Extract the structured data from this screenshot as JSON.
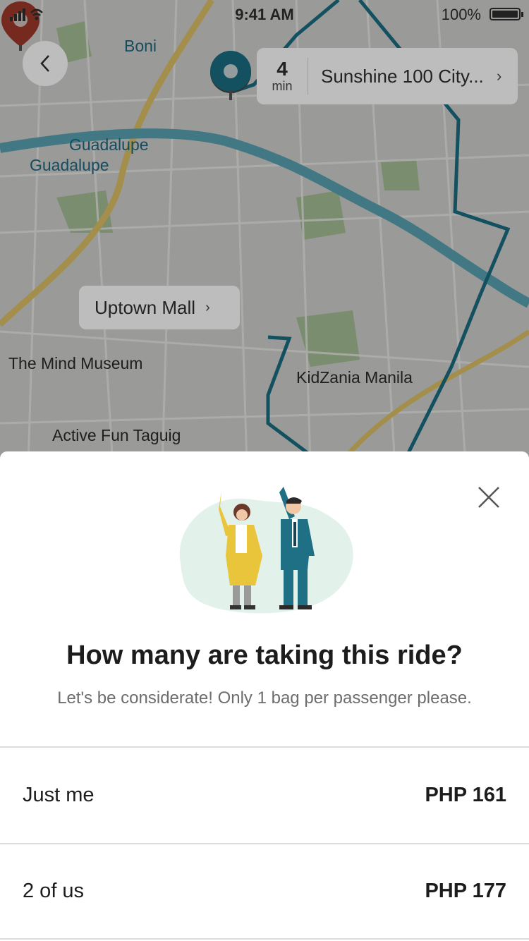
{
  "status_bar": {
    "time": "9:41 AM",
    "battery": "100%"
  },
  "map": {
    "eta": {
      "value": "4",
      "unit": "min",
      "destination": "Sunshine 100 City..."
    },
    "dropoff_label": "Uptown Mall",
    "labels": {
      "boni": "Boni",
      "guadalupe_1": "Guadalupe",
      "guadalupe_2": "Guadalupe",
      "mind_museum": "The Mind Museum",
      "kidzania": "KidZania Manila",
      "active_fun": "Active Fun Taguig"
    }
  },
  "sheet": {
    "title": "How many are taking this ride?",
    "subtitle": "Let's be considerate! Only 1 bag per passenger please.",
    "options": [
      {
        "label": "Just me",
        "price": "PHP 161"
      },
      {
        "label": "2 of us",
        "price": "PHP 177"
      }
    ]
  },
  "colors": {
    "route": "#1b6f85",
    "dropoff_pin": "#a23a2c",
    "accent_yellow": "#e8c53a"
  }
}
